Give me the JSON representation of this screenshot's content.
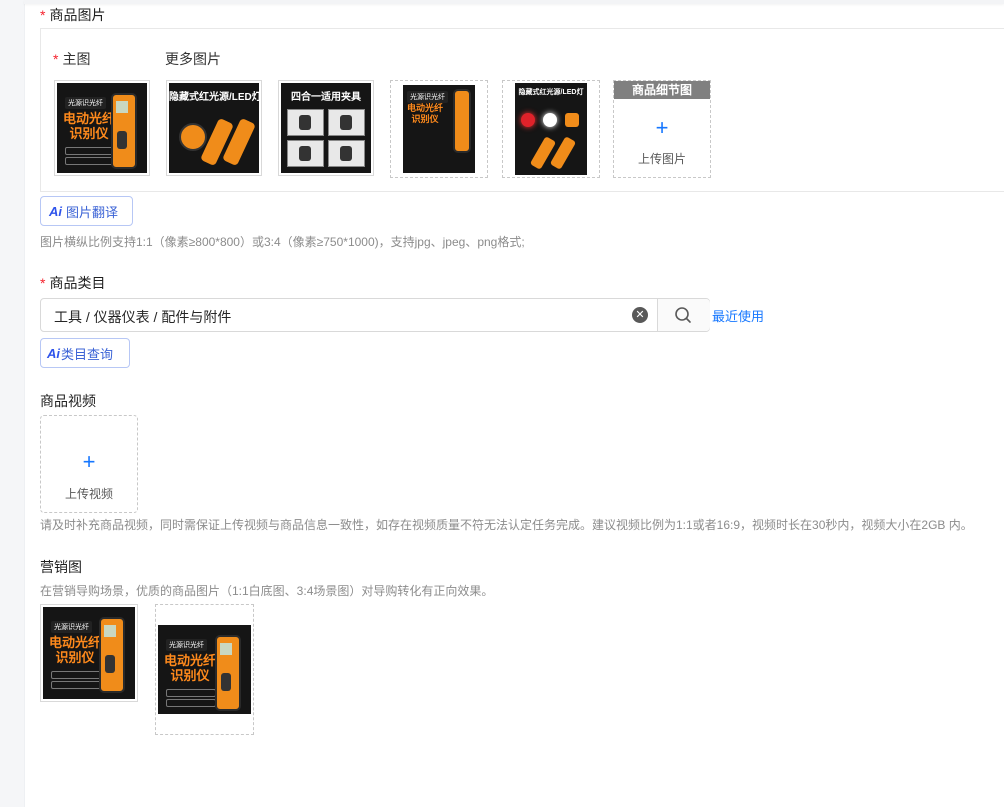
{
  "product_images": {
    "label": "商品图片",
    "main_label": "主图",
    "more_label": "更多图片",
    "thumbnails": [
      {
        "banner": "光源识光纤",
        "title": "电动光纤识别仪"
      },
      {
        "banner_top": "隐藏式红光源/LED灯"
      },
      {
        "banner_top": "四合一适用夹具"
      },
      {
        "banner": "光源识光纤",
        "title": "电动光纤识别仪"
      },
      {
        "banner_top": "隐藏式红光源/LED灯"
      }
    ],
    "detail_header": "商品细节图",
    "upload_label": "上传图片",
    "ai_translate": "图片翻译",
    "hint": "图片横纵比例支持1:1（像素≥800*800）或3:4（像素≥750*1000)，支持jpg、jpeg、png格式;"
  },
  "category": {
    "label": "商品类目",
    "value": "工具 / 仪器仪表 / 配件与附件",
    "recent_link": "最近使用",
    "ai_query": "类目查询"
  },
  "video": {
    "label": "商品视频",
    "upload_label": "上传视频",
    "hint": "请及时补充商品视频，同时需保证上传视频与商品信息一致性，如存在视频质量不符无法认定任务完成。建议视频比例为1:1或者16:9，视频时长在30秒内，视频大小在2GB 内。"
  },
  "marketing": {
    "label": "营销图",
    "hint": "在营销导购场景，优质的商品图片（1:1白底图、3:4场景图）对导购转化有正向效果。",
    "thumbnails": [
      {
        "banner": "光源识光纤",
        "title": "电动光纤识别仪"
      },
      {
        "banner": "光源识光纤",
        "title": "电动光纤识别仪"
      }
    ]
  },
  "ai_mark": "Ai",
  "colors": {
    "accent": "#1677ff",
    "required": "#f5222d"
  }
}
